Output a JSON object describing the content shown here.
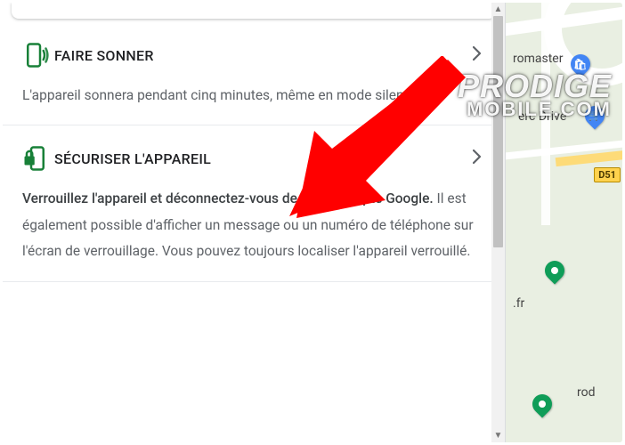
{
  "sections": [
    {
      "icon": "ring-phone-icon",
      "title": "FAIRE SONNER",
      "body_plain": "L'appareil sonnera pendant cinq minutes, même en mode silencieux."
    },
    {
      "icon": "lock-phone-icon",
      "title": "SÉCURISER L'APPAREIL",
      "body_bold": "Verrouillez l'appareil et déconnectez-vous de votre compte Google.",
      "body_rest": " Il est également possible d'afficher un message ou un numéro de téléphone sur l'écran de verrouillage. Vous pouvez toujours localiser l'appareil verrouillé."
    }
  ],
  "map": {
    "poi1": "romaster",
    "poi2": "erc Drive",
    "poi3": ".fr",
    "poi4": "rod",
    "road_badge": "D51"
  },
  "watermark": {
    "line1": "PRODIGE",
    "line2": "MOBILE.COM"
  },
  "colors": {
    "google_green": "#188038",
    "text_secondary": "#5f6368"
  }
}
